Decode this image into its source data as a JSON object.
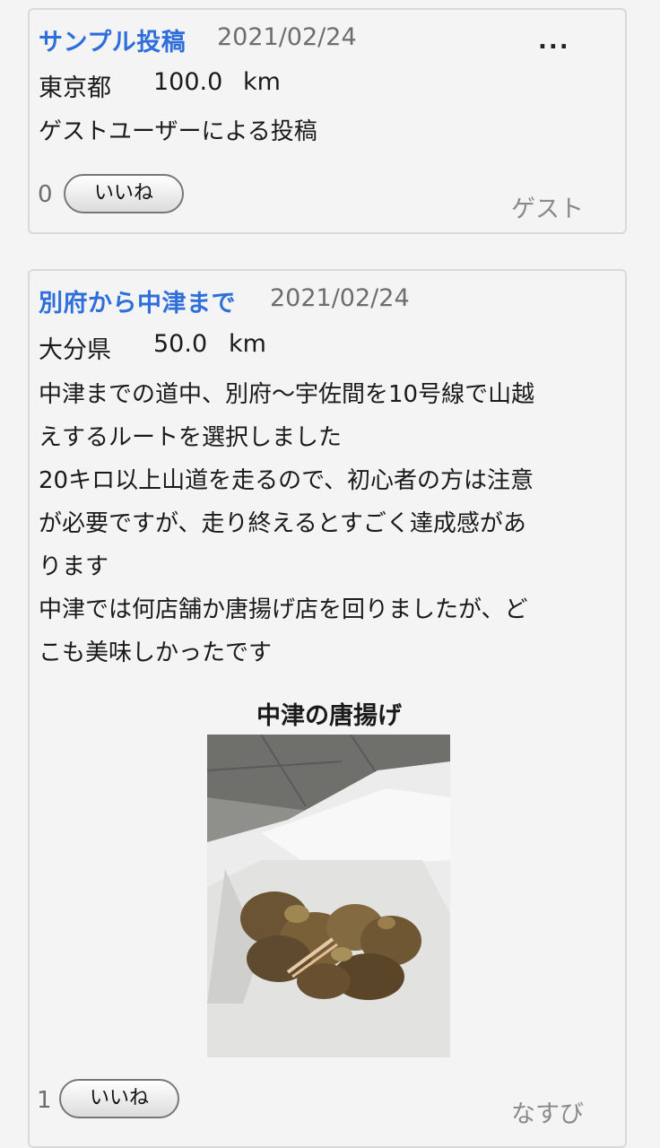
{
  "posts": [
    {
      "title": "サンプル投稿",
      "date": "2021/02/24",
      "prefecture": "東京都",
      "distance": "100.0",
      "unit": "km",
      "body": [
        "ゲストユーザーによる投稿"
      ],
      "likes": "0",
      "like_label": "いいね",
      "author": "ゲスト",
      "menu": "..."
    },
    {
      "title": "別府から中津まで",
      "date": "2021/02/24",
      "prefecture": "大分県",
      "distance": "50.0",
      "unit": "km",
      "body": [
        "中津までの道中、別府〜宇佐間を10号線で山越",
        "えするルートを選択しました",
        "20キロ以上山道を走るので、初心者の方は注意",
        "が必要ですが、走り終えるとすごく達成感があ",
        "ります",
        "中津では何店舗か唐揚げ店を回りましたが、ど",
        "こも美味しかったです"
      ],
      "image_caption": "中津の唐揚げ",
      "likes": "1",
      "like_label": "いいね",
      "author": "なすび"
    }
  ]
}
